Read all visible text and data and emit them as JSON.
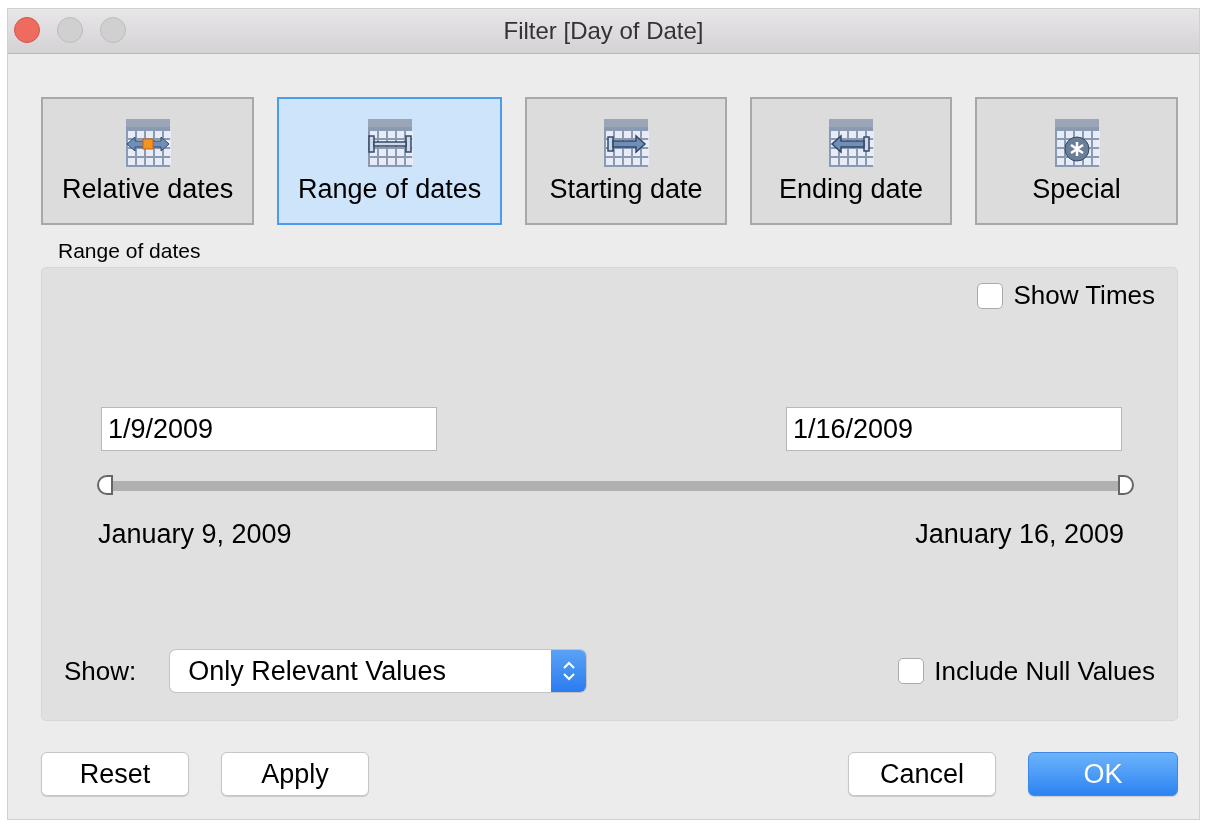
{
  "window": {
    "title": "Filter [Day of Date]"
  },
  "tabs": [
    {
      "label": "Relative dates",
      "kind": "relative",
      "selected": false
    },
    {
      "label": "Range of dates",
      "kind": "range",
      "selected": true
    },
    {
      "label": "Starting date",
      "kind": "starting",
      "selected": false
    },
    {
      "label": "Ending date",
      "kind": "ending",
      "selected": false
    },
    {
      "label": "Special",
      "kind": "special",
      "selected": false
    }
  ],
  "section_label": "Range of dates",
  "show_times": {
    "label": "Show Times",
    "checked": false
  },
  "start_field": {
    "value": "1/9/2009"
  },
  "end_field": {
    "value": "1/16/2009"
  },
  "slider": {
    "handles": [
      {
        "level": 0
      },
      {
        "level": 1
      }
    ]
  },
  "start_label": "January 9, 2009",
  "end_label": "January 16, 2009",
  "show": {
    "label": "Show:",
    "value": "Only Relevant Values"
  },
  "include_null": {
    "label": "Include Null Values",
    "checked": false
  },
  "buttons": [
    {
      "label": "Reset",
      "kind": "plain"
    },
    {
      "label": "Apply",
      "kind": "plain"
    },
    {
      "label": "Cancel",
      "kind": "plain"
    },
    {
      "label": "OK",
      "kind": "default"
    }
  ]
}
